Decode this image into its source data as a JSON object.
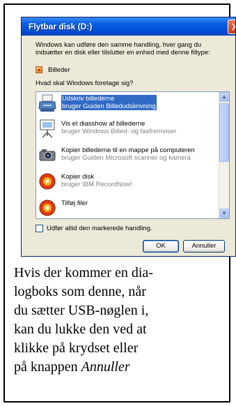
{
  "dialog": {
    "title": "Flytbar disk (D:)",
    "intro_line1": "Windows kan udføre den samme handling, hver gang du",
    "intro_line2": "indsætter en disk eller tilslutter en enhed med denne filtype:",
    "content_type": "Billeder",
    "question": "Hvad skal Windows foretage sig?",
    "actions": [
      {
        "label": "Udskriv billederne",
        "sublabel": "bruger Guiden Billedudskrivning",
        "icon": "printer-icon",
        "selected": true
      },
      {
        "label": "Vis et diasshow af billederne",
        "sublabel": "bruger Windows Billed- og faxfremviser",
        "icon": "slideshow-icon",
        "selected": false
      },
      {
        "label": "Kopier billederne til en mappe på computeren",
        "sublabel": "bruger Guiden Microsoft scanner og kamera",
        "icon": "camera-icon",
        "selected": false
      },
      {
        "label": "Kopier disk",
        "sublabel": "bruger IBM RecordNow!",
        "icon": "cd-burn-icon",
        "selected": false
      },
      {
        "label": "Tilføj filer",
        "sublabel": "",
        "icon": "cd-burn-icon",
        "selected": false
      }
    ],
    "always_checkbox_label": "Udfør altid den markerede handling.",
    "always_checked": false,
    "ok_label": "OK",
    "cancel_label": "Annuller",
    "close_glyph": "X"
  },
  "caption": {
    "line1": "Hvis der kommer en dia-",
    "line2": "logboks som denne, når",
    "line3": "du sætter USB-nøglen i,",
    "line4": "kan du lukke den ved at",
    "line5": "klikke på krydset eller",
    "line6_prefix": "på knappen ",
    "line6_italic": "Annuller"
  },
  "colors": {
    "titlebar": "#0050d8",
    "dialog_bg": "#ece9d8",
    "selection": "#316ac5",
    "list_border": "#7f9db9"
  }
}
